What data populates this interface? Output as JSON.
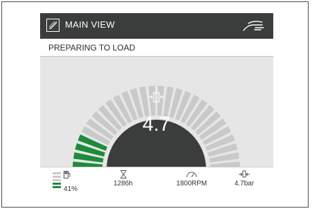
{
  "header": {
    "title": "MAIN VIEW",
    "view_icon": "main-view-icon",
    "hand_icon": "hand-touch-icon"
  },
  "status": {
    "text": "PREPARING TO LOAD"
  },
  "gauge": {
    "value_text": "4.7",
    "value": 4.7,
    "center_icon": "load-cylinder-icon",
    "segment_count": 28,
    "active_segments": 4,
    "active_color": "#1e8a3c",
    "inactive_color": "#c9c9c9",
    "center_color": "#3a3d3c"
  },
  "footer": {
    "fuel": {
      "icon": "fuel-pump-icon",
      "value": "41%",
      "level": 0.41
    },
    "hours": {
      "icon": "hourglass-icon",
      "value": "1286h"
    },
    "rpm": {
      "icon": "speedometer-icon",
      "value": "1800RPM"
    },
    "pressure": {
      "icon": "load-cylinder-icon",
      "value": "4.7bar"
    }
  }
}
